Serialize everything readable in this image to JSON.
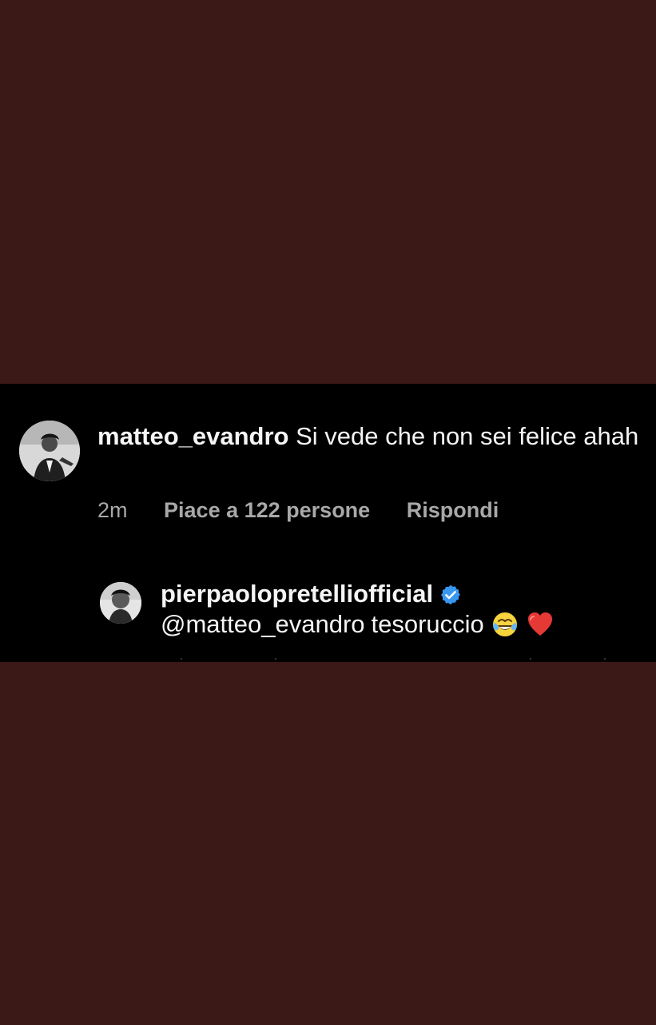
{
  "comment": {
    "username": "matteo_evandro",
    "text": "Si vede che non sei felice ahah",
    "time": "2m",
    "likes": "Piace a 122 persone",
    "reply": "Rispondi"
  },
  "reply": {
    "username": "pierpaolopretelliofficial",
    "mention": "@matteo_evandro",
    "text": "tesoruccio",
    "emojis": [
      "face-with-tears-of-joy-icon",
      "red-heart-icon"
    ],
    "verified": true
  },
  "colors": {
    "background": "#3a1916",
    "panel": "#000000",
    "text": "#f5f5f5",
    "muted": "#a8a8a8",
    "verified": "#3897f0"
  }
}
